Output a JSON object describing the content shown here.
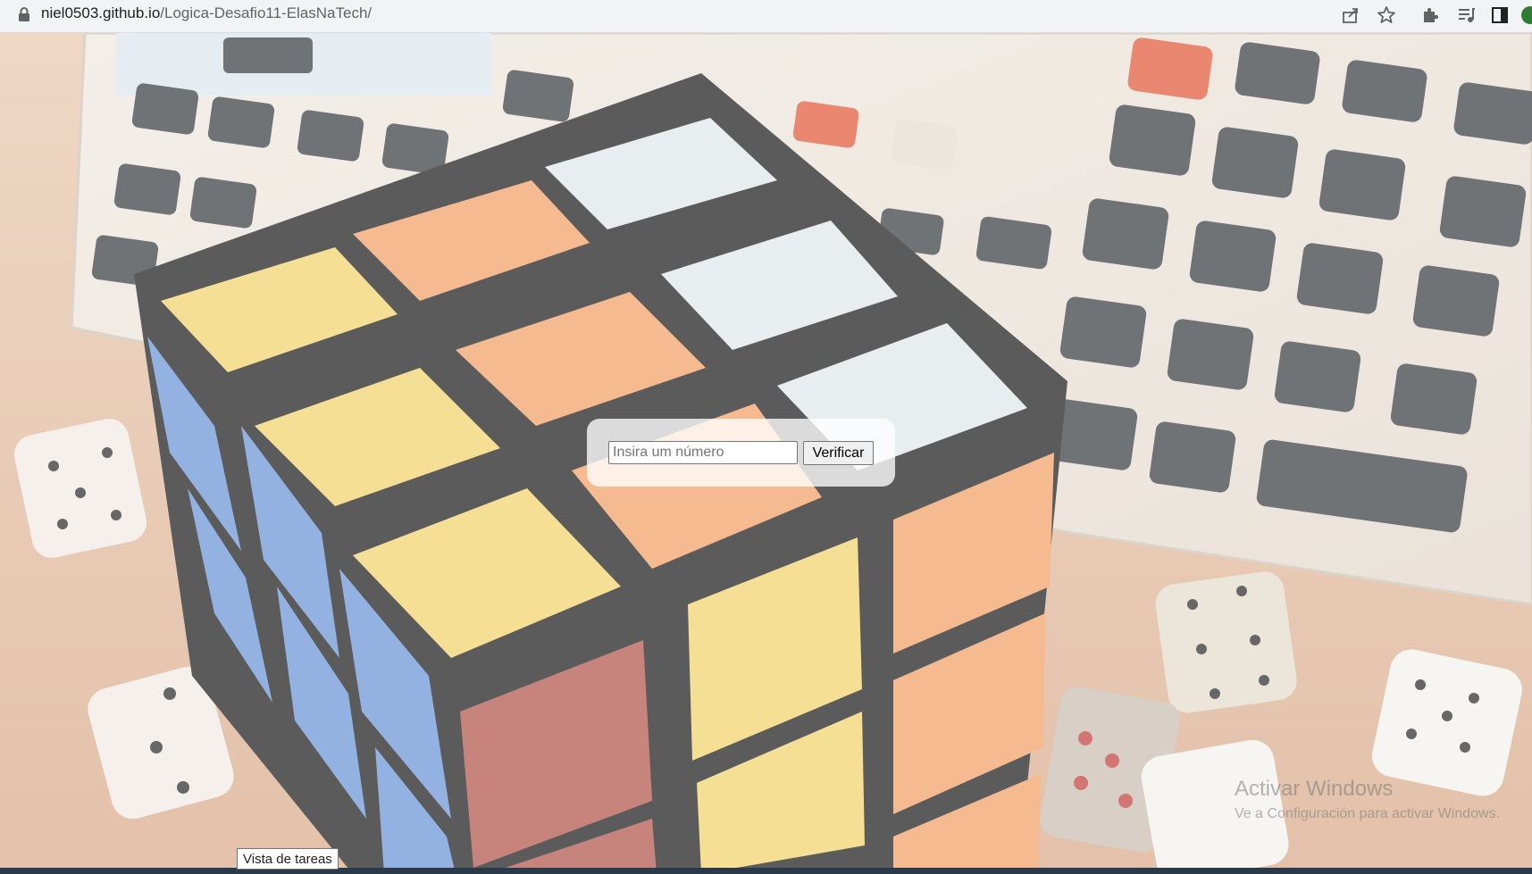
{
  "browser": {
    "url_host": "niel0503.github.io",
    "url_path": "/Logica-Desafio11-ElasNaTech/",
    "icons": [
      "lock-icon",
      "share-icon",
      "bookmark-star-icon",
      "extensions-icon",
      "reading-list-icon",
      "side-panel-icon",
      "profile-icon"
    ]
  },
  "page": {
    "background_image": "rubiks-cube-calculator-dice-photo",
    "form": {
      "input_placeholder": "Insira um número",
      "input_value": "",
      "button_label": "Verificar"
    }
  },
  "tooltip": {
    "text": "Vista de tareas"
  },
  "windows_watermark": {
    "title": "Activar Windows",
    "subtitle": "Ve a Configuración para activar Windows."
  },
  "colors": {
    "cube_yellow": "#f2d36b",
    "cube_orange": "#f2a066",
    "cube_blue": "#6a95d6",
    "cube_white": "#dfe6ea",
    "cube_red": "#b2554b"
  }
}
